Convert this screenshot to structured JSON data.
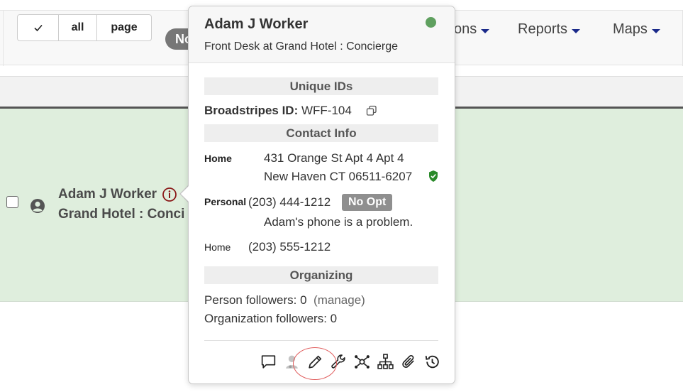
{
  "toolbar": {
    "select_check": "✓",
    "select_all": "all",
    "select_page": "page",
    "pill_label": "No",
    "menu_partial": "ons",
    "reports": "Reports",
    "maps": "Maps"
  },
  "row": {
    "name": "Adam J Worker",
    "subtitle": "Grand Hotel : Conci"
  },
  "popover": {
    "name": "Adam J Worker",
    "job": "Front Desk at Grand Hotel : Concierge",
    "status_color": "#5fa05f",
    "sections": {
      "unique_ids": "Unique IDs",
      "contact_info": "Contact Info",
      "organizing": "Organizing"
    },
    "broadstripes_label": "Broadstripes ID:",
    "broadstripes_value": "WFF-104",
    "address": {
      "label": "Home",
      "line1": "431 Orange St Apt 4 Apt 4",
      "line2": "New Haven CT 06511-6207"
    },
    "personal_phone": {
      "label": "Personal",
      "number": "(203) 444-1212",
      "badge": "No Opt",
      "note": "Adam's phone is a problem."
    },
    "home_phone": {
      "label": "Home",
      "number": "(203) 555-1212"
    },
    "person_followers_label": "Person followers:",
    "person_followers_count": "0",
    "manage": "(manage)",
    "org_followers_label": "Organization followers:",
    "org_followers_count": "0"
  }
}
